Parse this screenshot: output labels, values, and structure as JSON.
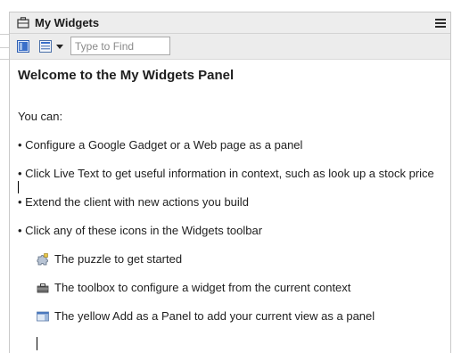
{
  "window": {
    "title": "My Widgets",
    "title_icon": "briefcase-icon",
    "menu_icon": "hamburger-menu-icon"
  },
  "toolbar": {
    "buttons": [
      {
        "icon": "blue-panel-icon"
      },
      {
        "icon": "list-view-icon"
      },
      {
        "icon": "dropdown-arrow-icon"
      }
    ],
    "find_placeholder": "Type to Find",
    "find_value": ""
  },
  "content": {
    "heading": "Welcome to the My Widgets Panel",
    "intro": "You can:",
    "bullets": [
      "• Configure a Google Gadget or a Web page as a panel",
      "• Click Live Text to get useful information in context, such as look up a stock price",
      "• Extend the client with new actions you build",
      "• Click any of these icons in the Widgets toolbar"
    ],
    "toolbar_icons": [
      {
        "icon": "puzzle-icon",
        "text": "The puzzle to get started"
      },
      {
        "icon": "toolbox-icon",
        "text": "The toolbox to configure a widget from the current context"
      },
      {
        "icon": "add-as-panel-icon",
        "text": "The yellow Add as a Panel to add your current view as a panel"
      }
    ]
  },
  "colors": {
    "titlebar_bg": "#ededed",
    "toolbar_bg": "#ececec",
    "accent_blue": "#2f5fb3"
  }
}
